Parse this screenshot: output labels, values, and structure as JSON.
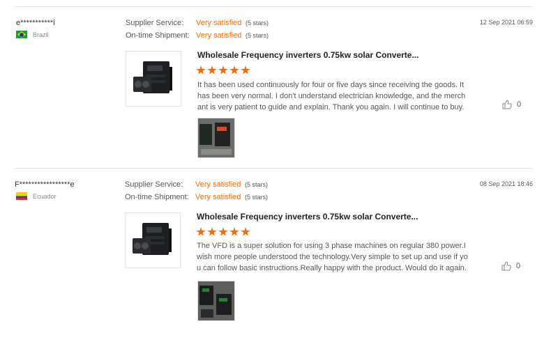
{
  "reviews": [
    {
      "user": "e***********i",
      "country": "Brazil",
      "supplier_service_label": "Supplier Service:",
      "supplier_service_value": "Very satisfied",
      "supplier_service_stars": "(5 stars)",
      "shipment_label": "On-time Shipment:",
      "shipment_value": "Very satisfied",
      "shipment_stars": "(5 stars)",
      "date": "12 Sep 2021 06:59",
      "product_title": "Wholesale Frequency inverters 0.75kw solar Converte...",
      "rating": 5,
      "text": "It has been used continuously for four or five days since receiving the goods. It has been very normal. I don't understand electrician knowledge, and the merchant is very patient to guide and explain. Thank you again. I will continue to buy.",
      "likes": "0"
    },
    {
      "user": "F*****************e",
      "country": "Ecuador",
      "supplier_service_label": "Supplier Service:",
      "supplier_service_value": "Very satisfied",
      "supplier_service_stars": "(5 stars)",
      "shipment_label": "On-time Shipment:",
      "shipment_value": "Very satisfied",
      "shipment_stars": "(5 stars)",
      "date": "08 Sep 2021 18:46",
      "product_title": "Wholesale Frequency inverters 0.75kw solar Converte...",
      "rating": 5,
      "text": "The VFD is a super solution for using 3 phase machines on regular 380 power.I wish more people understood the technology.Very simple to set up and use if you can follow basic instructions.Really happy with the product. Would do it again.",
      "likes": "0"
    }
  ]
}
